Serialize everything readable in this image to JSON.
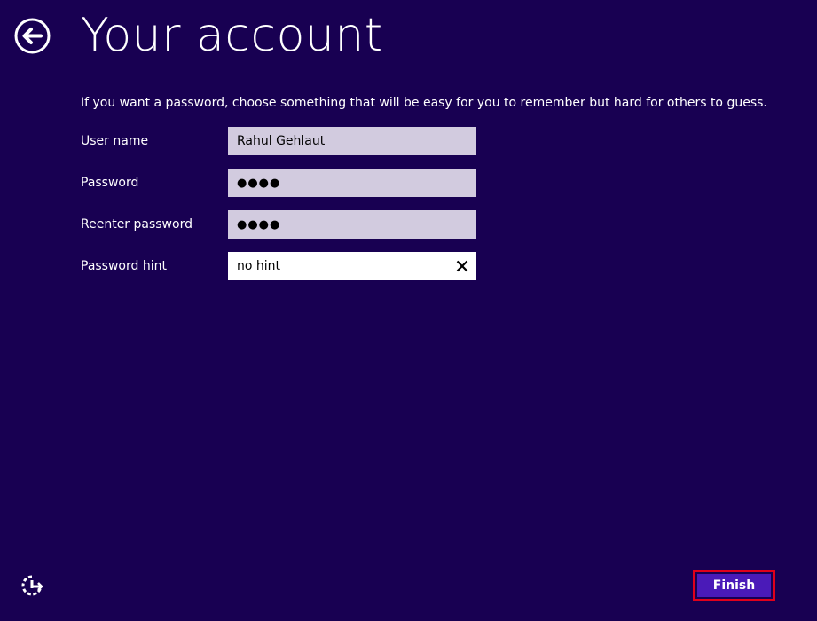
{
  "header": {
    "title": "Your account",
    "back_icon": "back-arrow-circle-icon"
  },
  "instructions": "If you want a password, choose something that will be easy for you to remember but hard for others to guess.",
  "form": {
    "username": {
      "label": "User name",
      "value": "Rahul Gehlaut"
    },
    "password": {
      "label": "Password",
      "value": "●●●●"
    },
    "reenter_password": {
      "label": "Reenter password",
      "value": "●●●●"
    },
    "password_hint": {
      "label": "Password hint",
      "value": "no hint",
      "clear_icon": "close-icon"
    }
  },
  "footer": {
    "ease_of_access_icon": "ease-of-access-icon",
    "finish_label": "Finish"
  },
  "colors": {
    "background": "#180052",
    "field_background": "#d2cbdf",
    "active_field_background": "#ffffff",
    "finish_button": "#4a1ab8",
    "finish_highlight": "#e0001b"
  }
}
